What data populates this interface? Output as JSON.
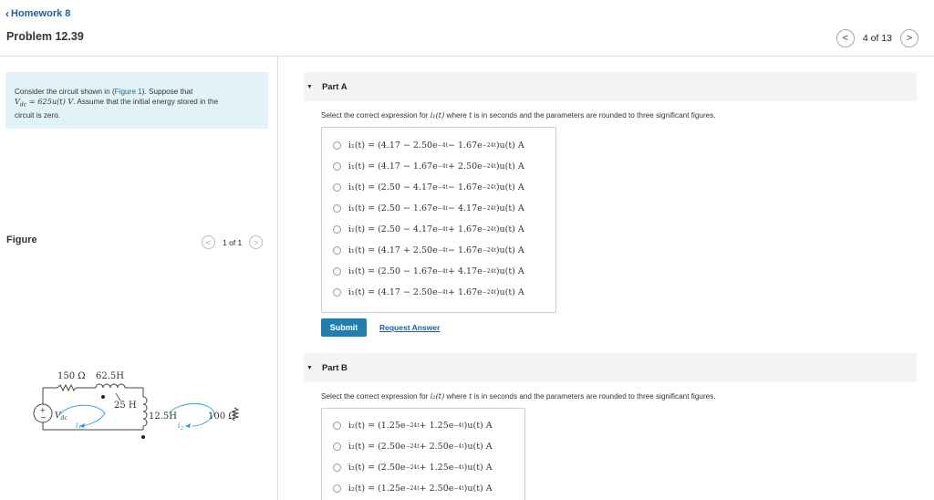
{
  "nav": {
    "back_label": "Homework 8"
  },
  "problem": {
    "title": "Problem 12.39"
  },
  "pager": {
    "text": "4 of 13",
    "prev": "<",
    "next": ">"
  },
  "description": {
    "line1a": "Consider the circuit shown in (",
    "figure_link": "Figure 1",
    "line1b": "). Suppose that",
    "math": "V",
    "math_sub": "dc",
    "math_rest": " = 625u(t) V",
    "line2": ". Assume that the initial energy stored in the",
    "line3": "circuit is zero."
  },
  "figure": {
    "label": "Figure",
    "pager_text": "1 of 1",
    "prev": "<",
    "next": ">"
  },
  "circuit": {
    "r1": "150 Ω",
    "l1": "62.5H",
    "m": "25 H",
    "l2": "12.5H",
    "r2": "100 Ω",
    "source_plus": "+",
    "source_minus": "−",
    "source_label": "V",
    "source_sub": "dc",
    "i1": "i",
    "i1_sub": "1",
    "i2": "i",
    "i2_sub": "2"
  },
  "part_a": {
    "title": "Part A",
    "instr_before": "Select the correct expression for ",
    "instr_var": "i₁(t)",
    "instr_mid": " where ",
    "instr_t": "t",
    "instr_after": " is in seconds and the parameters are rounded to three significant figures.",
    "options": [
      {
        "lhs": "i₁(t) = (4.17 − 2.50e",
        "e1": "−4t",
        "mid": " − 1.67e",
        "e2": "−24t",
        "rhs": ")u(t) A"
      },
      {
        "lhs": "i₁(t) = (4.17 − 1.67e",
        "e1": "−4t",
        "mid": " + 2.50e",
        "e2": "−24t",
        "rhs": ")u(t) A"
      },
      {
        "lhs": "i₁(t) = (2.50 − 4.17e",
        "e1": "−4t",
        "mid": " − 1.67e",
        "e2": "−24t",
        "rhs": ")u(t) A"
      },
      {
        "lhs": "i₁(t) = (2.50 − 1.67e",
        "e1": "−4t",
        "mid": " − 4.17e",
        "e2": "−24t",
        "rhs": ")u(t) A"
      },
      {
        "lhs": "i₁(t) = (2.50 − 4.17e",
        "e1": "−4t",
        "mid": " + 1.67e",
        "e2": "−24t",
        "rhs": ")u(t) A"
      },
      {
        "lhs": "i₁(t) = (4.17 + 2.50e",
        "e1": "−4t",
        "mid": " − 1.67e",
        "e2": "−24t",
        "rhs": ")u(t) A"
      },
      {
        "lhs": "i₁(t) = (2.50 − 1.67e",
        "e1": "−4t",
        "mid": " + 4.17e",
        "e2": "−24t",
        "rhs": ")u(t) A"
      },
      {
        "lhs": "i₁(t) = (4.17 − 2.50e",
        "e1": "−4t",
        "mid": " + 1.67e",
        "e2": "−24t",
        "rhs": ")u(t) A"
      }
    ],
    "submit_label": "Submit",
    "request_label": "Request Answer"
  },
  "part_b": {
    "title": "Part B",
    "instr_before": "Select the correct expression for ",
    "instr_var": "i₂(t)",
    "instr_mid": " where ",
    "instr_t": "t",
    "instr_after": " is in seconds and the parameters are rounded to three significant figures.",
    "options": [
      {
        "lhs": "i₂(t) = (1.25e",
        "e1": "−24t",
        "mid": " + 1.25e",
        "e2": "−4t",
        "rhs": ")u(t) A"
      },
      {
        "lhs": "i₂(t) = (2.50e",
        "e1": "−24t",
        "mid": " + 2.50e",
        "e2": "−4t",
        "rhs": ")u(t) A"
      },
      {
        "lhs": "i₂(t) = (2.50e",
        "e1": "−24t",
        "mid": " + 1.25e",
        "e2": "−4t",
        "rhs": ")u(t) A"
      },
      {
        "lhs": "i₂(t) = (1.25e",
        "e1": "−24t",
        "mid": " + 2.50e",
        "e2": "−4t",
        "rhs": ")u(t) A"
      }
    ]
  },
  "colors": {
    "accent": "#1f7fb0",
    "link": "#1b5f9e",
    "desc_bg": "#e2f3f8",
    "current_arrow": "#2a9fd6"
  }
}
